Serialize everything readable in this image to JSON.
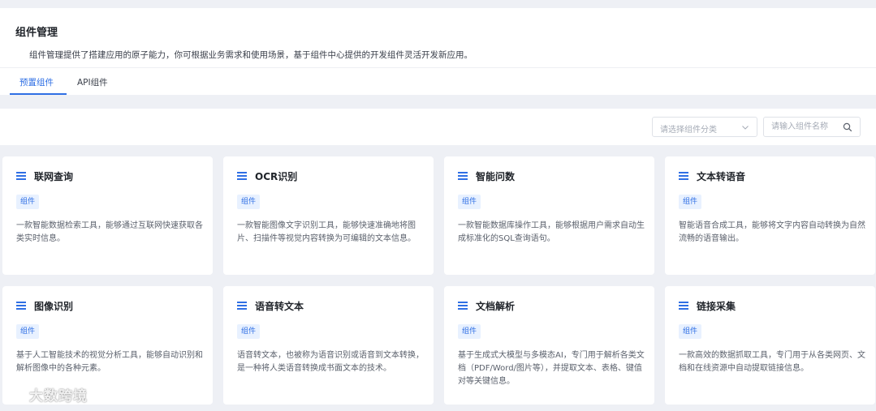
{
  "header": {
    "title": "组件管理",
    "description": "组件管理提供了搭建应用的原子能力，你可根据业务需求和使用场景，基于组件中心提供的开发组件灵活开发新应用。"
  },
  "tabs": [
    {
      "label": "预置组件",
      "active": true
    },
    {
      "label": "API组件",
      "active": false
    }
  ],
  "filters": {
    "category_placeholder": "请选择组件分类",
    "search_placeholder": "请输入组件名称"
  },
  "colors": {
    "accent": "#2f6fe4",
    "badge_bg": "#e8f1ff",
    "page_bg": "#eef0f5"
  },
  "cards": [
    {
      "title": "联网查询",
      "badge": "组件",
      "description": "一款智能数据检索工具，能够通过互联网快速获取各类实时信息。",
      "icon": "list-icon"
    },
    {
      "title": "OCR识别",
      "badge": "组件",
      "description": "一款智能图像文字识别工具，能够快速准确地将图片、扫描件等视觉内容转换为可编辑的文本信息。",
      "icon": "list-icon"
    },
    {
      "title": "智能问数",
      "badge": "组件",
      "description": "一款智能数据库操作工具，能够根据用户需求自动生成标准化的SQL查询语句。",
      "icon": "list-icon"
    },
    {
      "title": "文本转语音",
      "badge": "组件",
      "description": "智能语音合成工具，能够将文字内容自动转换为自然流畅的语音输出。",
      "icon": "list-icon"
    },
    {
      "title": "图像识别",
      "badge": "组件",
      "description": "基于人工智能技术的视觉分析工具，能够自动识别和解析图像中的各种元素。",
      "icon": "list-icon"
    },
    {
      "title": "语音转文本",
      "badge": "组件",
      "description": "语音转文本，也被称为语音识别或语音到文本转换，是一种将人类语音转换成书面文本的技术。",
      "icon": "list-icon"
    },
    {
      "title": "文档解析",
      "badge": "组件",
      "description": "基于生成式大模型与多模态AI，专门用于解析各类文档（PDF/Word/图片等），并提取文本、表格、键值对等关键信息。",
      "icon": "list-icon"
    },
    {
      "title": "链接采集",
      "badge": "组件",
      "description": "一款高效的数据抓取工具，专门用于从各类网页、文档和在线资源中自动提取链接信息。",
      "icon": "list-icon"
    }
  ],
  "watermark": "大数跨境"
}
